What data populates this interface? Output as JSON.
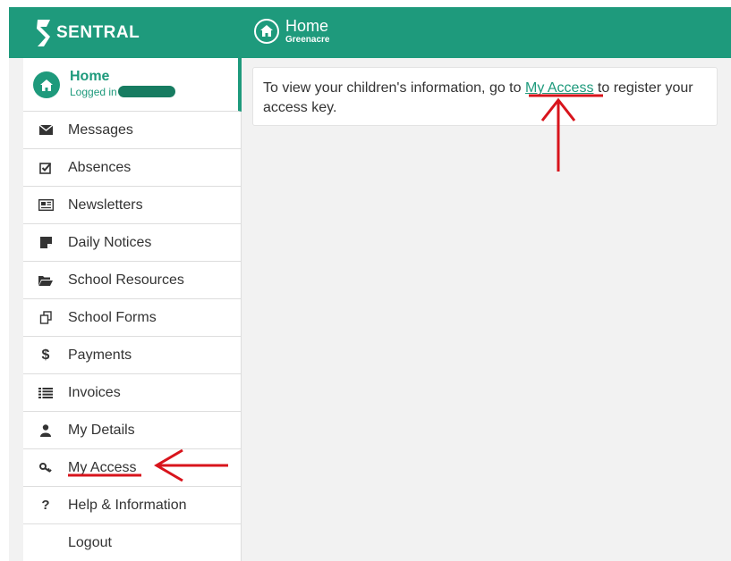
{
  "brand": {
    "name": "SENTRAL"
  },
  "header": {
    "title": "Home",
    "subtitle": "Greenacre"
  },
  "sidebar": {
    "home": {
      "title": "Home",
      "logged_in_label": "Logged in"
    },
    "items": [
      {
        "label": "Messages",
        "icon": "envelope-icon"
      },
      {
        "label": "Absences",
        "icon": "checkbox-icon"
      },
      {
        "label": "Newsletters",
        "icon": "newspaper-icon"
      },
      {
        "label": "Daily Notices",
        "icon": "note-icon"
      },
      {
        "label": "School Resources",
        "icon": "folder-icon"
      },
      {
        "label": "School Forms",
        "icon": "forms-icon"
      },
      {
        "label": "Payments",
        "icon": "dollar-icon"
      },
      {
        "label": "Invoices",
        "icon": "list-icon"
      },
      {
        "label": "My Details",
        "icon": "user-icon"
      },
      {
        "label": "My Access",
        "icon": "key-icon"
      },
      {
        "label": "Help & Information",
        "icon": "question-icon"
      },
      {
        "label": "Logout"
      }
    ]
  },
  "main": {
    "message_before": "To view your children's information, go to",
    "message_link": "My Access",
    "message_after": "to register your access key."
  },
  "colors": {
    "brand": "#1e9a7c",
    "annotation": "#d8141c"
  }
}
